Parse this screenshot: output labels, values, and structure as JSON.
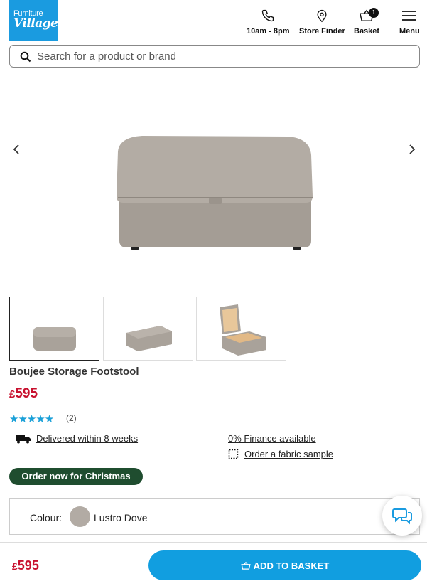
{
  "logo": {
    "line1": "Furniture",
    "line2": "Village"
  },
  "header": {
    "phone_label": "10am - 8pm",
    "store_label": "Store Finder",
    "basket_label": "Basket",
    "basket_count": "1",
    "menu_label": "Menu"
  },
  "search": {
    "placeholder": "Search for a product or brand"
  },
  "product": {
    "name": "Boujee Storage Footstool",
    "price_symbol": "£",
    "price_value": "595",
    "stars": "★★★★★",
    "rating": 5,
    "review_count": "(2)",
    "delivery": "Delivered within 8 weeks",
    "finance": "0% Finance available",
    "sample": "Order a fabric sample",
    "promo": "Order now for Christmas",
    "colour_label": "Colour:",
    "colour_value": "Lustro Dove",
    "colour_hex": "#b2aba4"
  },
  "footer": {
    "price_symbol": "£",
    "price_value": "595",
    "add_label": "ADD TO BASKET"
  },
  "colors": {
    "brand": "#1a9be0",
    "price": "#c8102e",
    "promo": "#1f4d2f",
    "button": "#119ee0"
  }
}
